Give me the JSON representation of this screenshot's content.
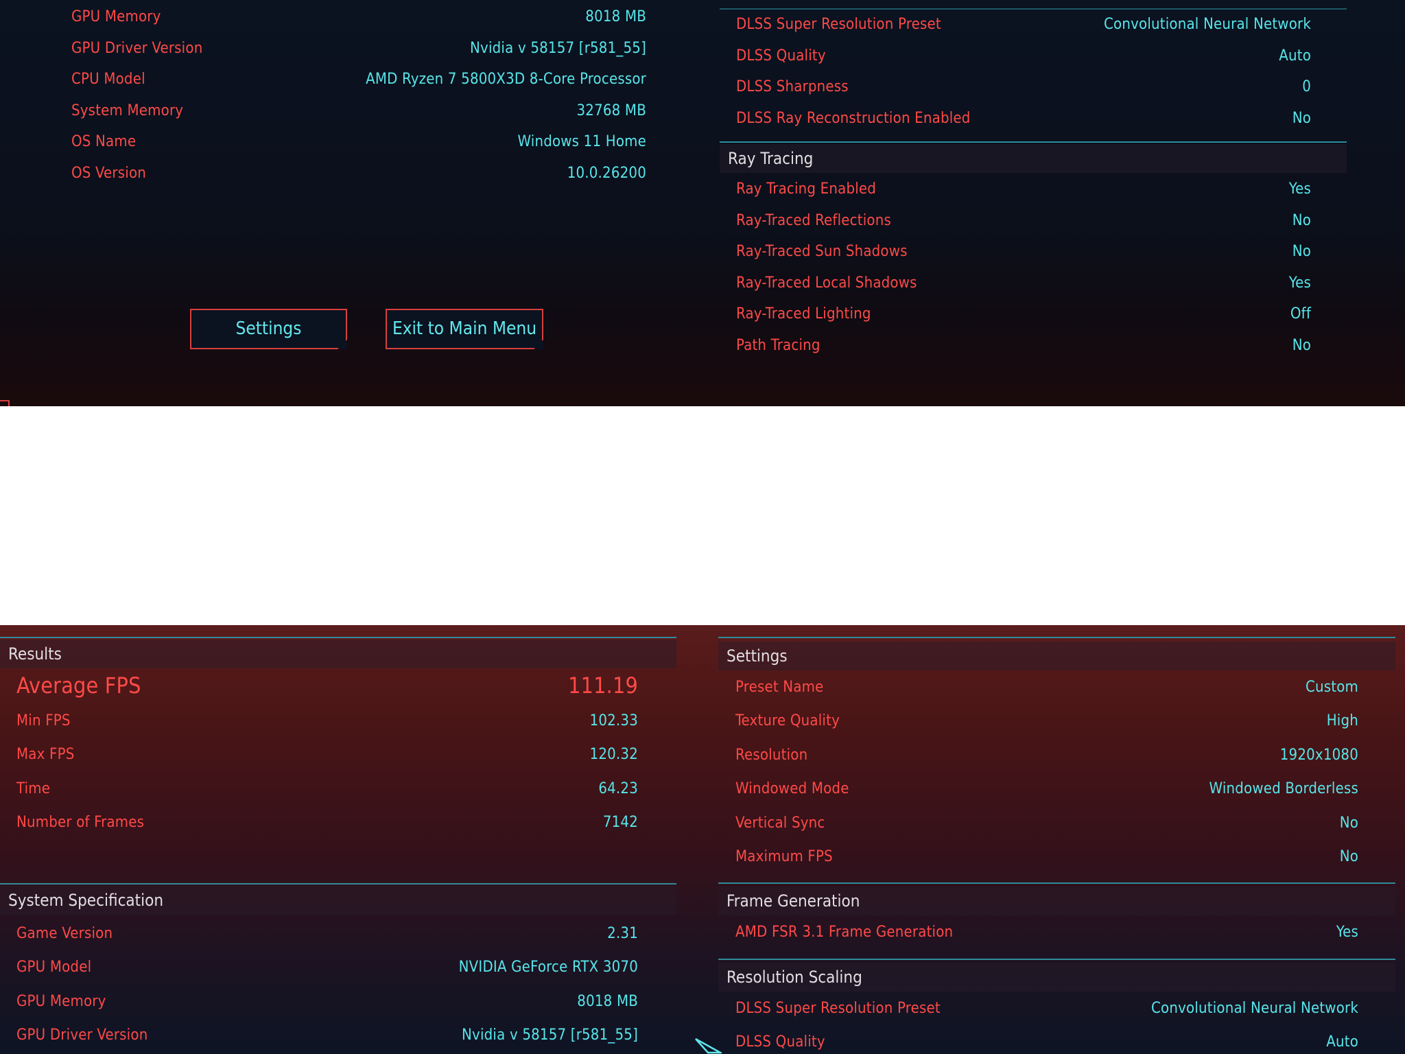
{
  "top": {
    "system": [
      {
        "label": "GPU Memory",
        "value": "8018 MB"
      },
      {
        "label": "GPU Driver Version",
        "value": "Nvidia v 58157 [r581_55]"
      },
      {
        "label": "CPU Model",
        "value": "AMD Ryzen 7 5800X3D 8-Core Processor"
      },
      {
        "label": "System Memory",
        "value": "32768 MB"
      },
      {
        "label": "OS Name",
        "value": "Windows 11 Home"
      },
      {
        "label": "OS Version",
        "value": "10.0.26200"
      }
    ],
    "buttons": {
      "settings": "Settings",
      "exit": "Exit to Main Menu"
    },
    "dlss": [
      {
        "label": "DLSS Super Resolution Preset",
        "value": "Convolutional Neural Network"
      },
      {
        "label": "DLSS Quality",
        "value": "Auto"
      },
      {
        "label": "DLSS Sharpness",
        "value": "0"
      },
      {
        "label": "DLSS Ray Reconstruction Enabled",
        "value": "No"
      }
    ],
    "ray_tracing": {
      "title": "Ray Tracing",
      "items": [
        {
          "label": "Ray Tracing Enabled",
          "value": "Yes"
        },
        {
          "label": "Ray-Traced Reflections",
          "value": "No"
        },
        {
          "label": "Ray-Traced Sun Shadows",
          "value": "No"
        },
        {
          "label": "Ray-Traced Local Shadows",
          "value": "Yes"
        },
        {
          "label": "Ray-Traced Lighting",
          "value": "Off"
        },
        {
          "label": "Path Tracing",
          "value": "No"
        }
      ]
    }
  },
  "bottom": {
    "results": {
      "title": "Results",
      "average": {
        "label": "Average FPS",
        "value": "111.19"
      },
      "items": [
        {
          "label": "Min FPS",
          "value": "102.33"
        },
        {
          "label": "Max FPS",
          "value": "120.32"
        },
        {
          "label": "Time",
          "value": "64.23"
        },
        {
          "label": "Number of Frames",
          "value": "7142"
        }
      ]
    },
    "system_spec": {
      "title": "System Specification",
      "items": [
        {
          "label": "Game Version",
          "value": "2.31"
        },
        {
          "label": "GPU Model",
          "value": "NVIDIA GeForce RTX 3070"
        },
        {
          "label": "GPU Memory",
          "value": "8018 MB"
        },
        {
          "label": "GPU Driver Version",
          "value": "Nvidia v 58157 [r581_55]"
        }
      ]
    },
    "settings": {
      "title": "Settings",
      "items": [
        {
          "label": "Preset Name",
          "value": "Custom"
        },
        {
          "label": "Texture Quality",
          "value": "High"
        },
        {
          "label": "Resolution",
          "value": "1920x1080"
        },
        {
          "label": "Windowed Mode",
          "value": "Windowed Borderless"
        },
        {
          "label": "Vertical Sync",
          "value": "No"
        },
        {
          "label": "Maximum FPS",
          "value": "No"
        }
      ]
    },
    "frame_generation": {
      "title": "Frame Generation",
      "items": [
        {
          "label": "AMD FSR 3.1 Frame Generation",
          "value": "Yes"
        }
      ]
    },
    "resolution_scaling": {
      "title": "Resolution Scaling",
      "items": [
        {
          "label": "DLSS Super Resolution Preset",
          "value": "Convolutional Neural Network"
        },
        {
          "label": "DLSS Quality",
          "value": "Auto"
        }
      ]
    }
  }
}
